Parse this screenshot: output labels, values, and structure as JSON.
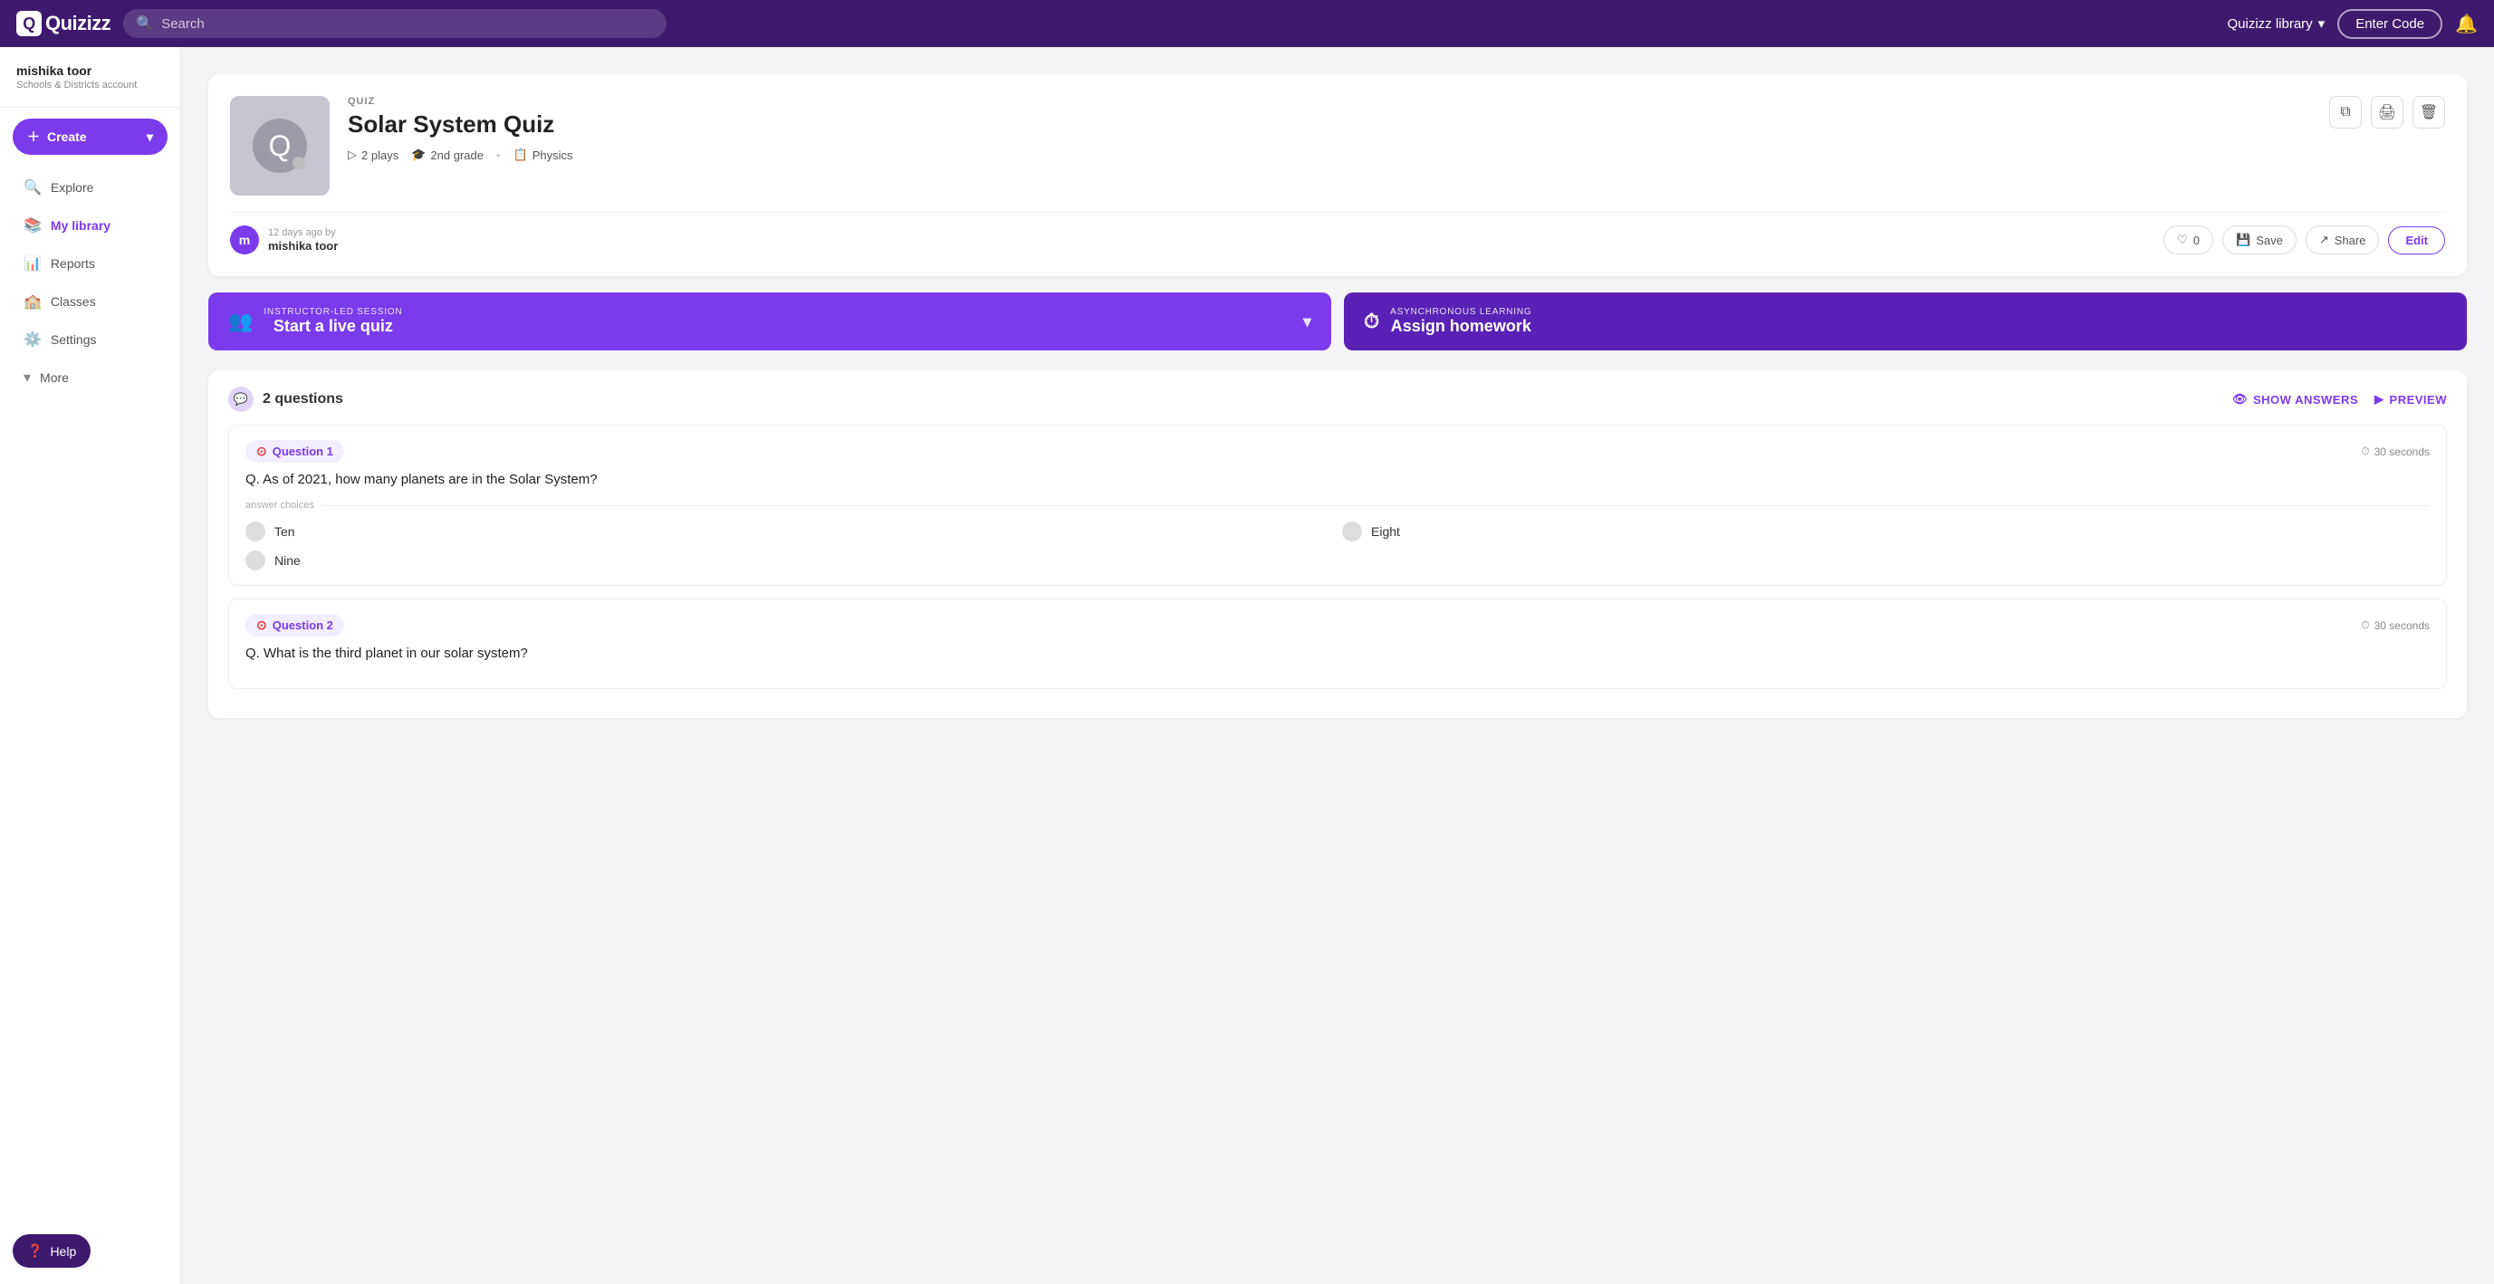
{
  "topnav": {
    "logo": "Quizizz",
    "search_placeholder": "Search",
    "library_label": "Quizizz library",
    "enter_code_label": "Enter Code"
  },
  "sidebar": {
    "user_name": "mishika toor",
    "user_role": "Schools & Districts account",
    "create_label": "Create",
    "nav_items": [
      {
        "id": "explore",
        "label": "Explore",
        "icon": "🔍"
      },
      {
        "id": "my-library",
        "label": "My library",
        "icon": "📚",
        "active": true
      },
      {
        "id": "reports",
        "label": "Reports",
        "icon": "📊"
      },
      {
        "id": "classes",
        "label": "Classes",
        "icon": "🏫"
      },
      {
        "id": "settings",
        "label": "Settings",
        "icon": "⚙️"
      },
      {
        "id": "more",
        "label": "More",
        "icon": "▾"
      }
    ],
    "help_label": "Help"
  },
  "quiz": {
    "label": "QUIZ",
    "title": "Solar System Quiz",
    "plays": "2 plays",
    "grade": "2nd grade",
    "subject": "Physics",
    "author_time": "12 days ago by",
    "author_name": "mishika toor",
    "author_initial": "m",
    "likes": "0",
    "like_label": "0",
    "save_label": "Save",
    "share_label": "Share",
    "edit_label": "Edit"
  },
  "actions": {
    "live_quiz_small": "INSTRUCTOR-LED SESSION",
    "live_quiz_main": "Start a live quiz",
    "homework_small": "ASYNCHRONOUS LEARNING",
    "homework_main": "Assign homework"
  },
  "questions_section": {
    "count_label": "2 questions",
    "show_answers_label": "SHOW ANSWERS",
    "preview_label": "PREVIEW",
    "questions": [
      {
        "id": 1,
        "badge": "Question 1",
        "time": "30 seconds",
        "text": "Q. As of 2021, how many planets are in the Solar System?",
        "answers_label": "answer choices",
        "answers": [
          "Ten",
          "Eight",
          "Nine"
        ]
      },
      {
        "id": 2,
        "badge": "Question 2",
        "time": "30 seconds",
        "text": "Q. What is the third planet in our solar system?"
      }
    ]
  }
}
